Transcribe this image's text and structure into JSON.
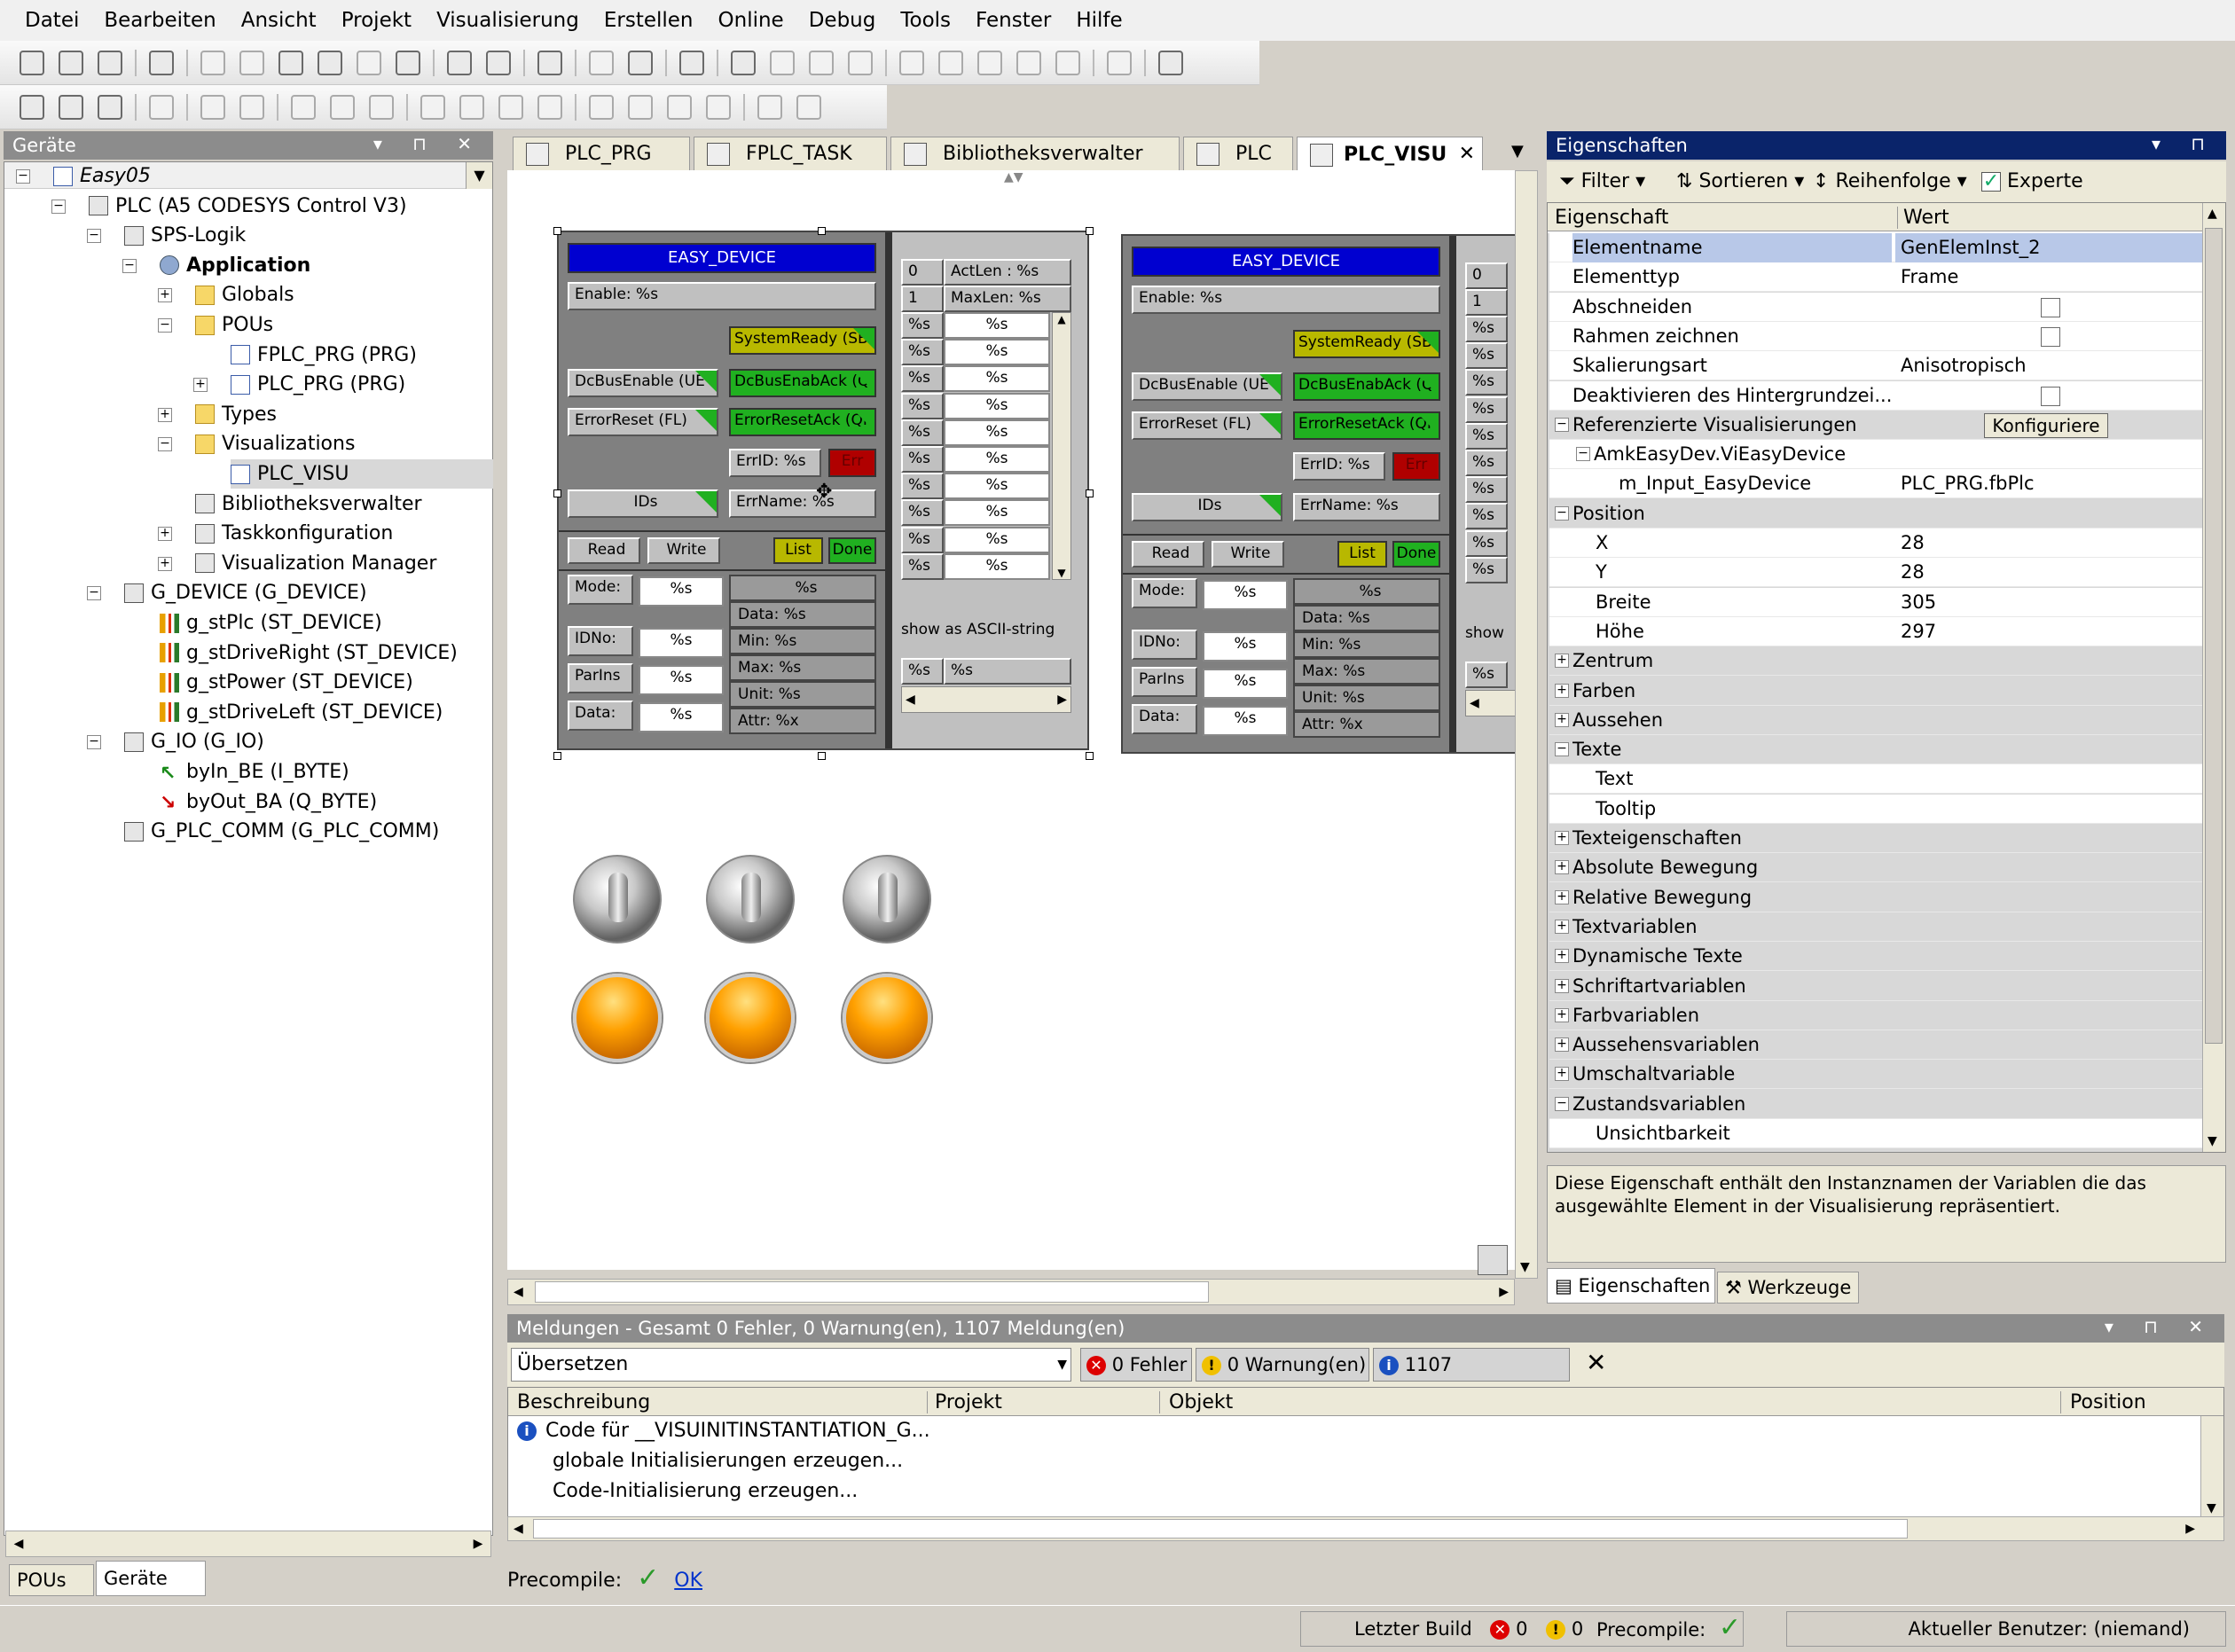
{
  "menu": [
    "Datei",
    "Bearbeiten",
    "Ansicht",
    "Projekt",
    "Visualisierung",
    "Erstellen",
    "Online",
    "Debug",
    "Tools",
    "Fenster",
    "Hilfe"
  ],
  "devices_panel": {
    "title": "Geräte",
    "tree": [
      {
        "label": "Easy05",
        "italic": true
      },
      {
        "label": "PLC (A5 CODESYS Control V3)"
      },
      {
        "label": "SPS-Logik"
      },
      {
        "label": "Application",
        "bold": true
      },
      {
        "label": "Globals"
      },
      {
        "label": "POUs"
      },
      {
        "label": "FPLC_PRG (PRG)"
      },
      {
        "label": "PLC_PRG (PRG)"
      },
      {
        "label": "Types"
      },
      {
        "label": "Visualizations"
      },
      {
        "label": "PLC_VISU",
        "selected": true
      },
      {
        "label": "Bibliotheksverwalter"
      },
      {
        "label": "Taskkonfiguration"
      },
      {
        "label": "Visualization Manager"
      },
      {
        "label": "G_DEVICE (G_DEVICE)"
      },
      {
        "label": "g_stPlc (ST_DEVICE)"
      },
      {
        "label": "g_stDriveRight (ST_DEVICE)"
      },
      {
        "label": "g_stPower (ST_DEVICE)"
      },
      {
        "label": "g_stDriveLeft (ST_DEVICE)"
      },
      {
        "label": "G_IO (G_IO)"
      },
      {
        "label": "byIn_BE (I_BYTE)"
      },
      {
        "label": "byOut_BA (Q_BYTE)"
      },
      {
        "label": "G_PLC_COMM (G_PLC_COMM)"
      }
    ],
    "bottom_tabs": [
      "POUs",
      "Geräte"
    ]
  },
  "editor_tabs": [
    "PLC_PRG",
    "FPLC_TASK",
    "Bibliotheksverwalter",
    "PLC",
    "PLC_VISU"
  ],
  "visu": {
    "device_title": "EASY_DEVICE",
    "enable": "Enable: %s",
    "system_ready": "SystemReady (SB",
    "dc_bus_enable": "DcBusEnable (UE",
    "dc_bus_enab_ack": "DcBusEnabAck (QU",
    "error_reset": "ErrorReset (FL)",
    "error_reset_ack": "ErrorResetAck (QF",
    "err_id": "ErrID: %s",
    "err": "Err",
    "ids": "IDs",
    "err_name": "ErrName: %s",
    "read": "Read",
    "write": "Write",
    "list": "List",
    "done": "Done",
    "mode": "Mode:",
    "idno": "IDNo:",
    "parins": "ParIns",
    "data": "Data:",
    "pct": "%s",
    "data_pct": "Data: %s",
    "min_pct": "Min: %s",
    "max_pct": "Max: %s",
    "unit_pct": "Unit: %s",
    "attr_pct": "Attr: %x",
    "list_row0": [
      "0",
      "ActLen : %s"
    ],
    "list_row1": [
      "1",
      "MaxLen: %s"
    ],
    "show_ascii": "show as ASCII-string",
    "show_short": "show"
  },
  "properties": {
    "title": "Eigenschaften",
    "toolbar": {
      "filter": "Filter",
      "sort": "Sortieren",
      "order": "Reihenfolge",
      "expert": "Experte"
    },
    "col_property": "Eigenschaft",
    "col_value": "Wert",
    "rows": [
      {
        "name": "Elementname",
        "value": "GenElemInst_2",
        "indent": 1,
        "selected": true
      },
      {
        "name": "Elementtyp",
        "value": "Frame",
        "indent": 1
      },
      {
        "name": "Abschneiden",
        "value": "",
        "indent": 1,
        "checkbox": true
      },
      {
        "name": "Rahmen zeichnen",
        "value": "",
        "indent": 1,
        "checkbox": true
      },
      {
        "name": "Skalierungsart",
        "value": "Anisotropisch",
        "indent": 1
      },
      {
        "name": "Deaktivieren des Hintergrundzei...",
        "value": "",
        "indent": 1,
        "checkbox": true
      },
      {
        "name": "Referenzierte Visualisierungen",
        "value": "",
        "indent": 1,
        "exp": "−",
        "button": "Konfiguriere"
      },
      {
        "name": "AmkEasyDev.ViEasyDevice",
        "value": "",
        "indent": 2,
        "exp": "−"
      },
      {
        "name": "m_Input_EasyDevice",
        "value": "PLC_PRG.fbPlc",
        "indent": 3
      },
      {
        "name": "Position",
        "value": "",
        "indent": 1,
        "exp": "−"
      },
      {
        "name": "X",
        "value": "28",
        "indent": 2
      },
      {
        "name": "Y",
        "value": "28",
        "indent": 2
      },
      {
        "name": "Breite",
        "value": "305",
        "indent": 2
      },
      {
        "name": "Höhe",
        "value": "297",
        "indent": 2
      },
      {
        "name": "Zentrum",
        "value": "",
        "indent": 1,
        "exp": "+"
      },
      {
        "name": "Farben",
        "value": "",
        "indent": 1,
        "exp": "+"
      },
      {
        "name": "Aussehen",
        "value": "",
        "indent": 1,
        "exp": "+"
      },
      {
        "name": "Texte",
        "value": "",
        "indent": 1,
        "exp": "−"
      },
      {
        "name": "Text",
        "value": "",
        "indent": 2
      },
      {
        "name": "Tooltip",
        "value": "",
        "indent": 2
      },
      {
        "name": "Texteigenschaften",
        "value": "",
        "indent": 1,
        "exp": "+"
      },
      {
        "name": "Absolute Bewegung",
        "value": "",
        "indent": 1,
        "exp": "+"
      },
      {
        "name": "Relative Bewegung",
        "value": "",
        "indent": 1,
        "exp": "+"
      },
      {
        "name": "Textvariablen",
        "value": "",
        "indent": 1,
        "exp": "+"
      },
      {
        "name": "Dynamische Texte",
        "value": "",
        "indent": 1,
        "exp": "+"
      },
      {
        "name": "Schriftartvariablen",
        "value": "",
        "indent": 1,
        "exp": "+"
      },
      {
        "name": "Farbvariablen",
        "value": "",
        "indent": 1,
        "exp": "+"
      },
      {
        "name": "Aussehensvariablen",
        "value": "",
        "indent": 1,
        "exp": "+"
      },
      {
        "name": "Umschaltvariable",
        "value": "",
        "indent": 1,
        "exp": "+"
      },
      {
        "name": "Zustandsvariablen",
        "value": "",
        "indent": 1,
        "exp": "−"
      },
      {
        "name": "Unsichtbarkeit",
        "value": "",
        "indent": 2
      }
    ],
    "description": "Diese Eigenschaft enthält den Instanznamen der Variablen die das ausgewählte Element in der Visualisierung repräsentiert.",
    "tabs": [
      "Eigenschaften",
      "Werkzeuge"
    ]
  },
  "messages": {
    "title": "Meldungen - Gesamt 0 Fehler, 0 Warnung(en), 1107 Meldung(en)",
    "source": "Übersetzen",
    "errors": "0 Fehler",
    "warnings": "0 Warnung(en)",
    "infos": "1107 Meldung(en)",
    "cols": [
      "Beschreibung",
      "Projekt",
      "Objekt",
      "Position"
    ],
    "rows": [
      "Code für __VISUINITINSTANTIATION_G...",
      "globale Initialisierungen erzeugen...",
      "Code-Initialisierung erzeugen..."
    ]
  },
  "precompile": {
    "label": "Precompile:",
    "status": "OK"
  },
  "status": {
    "last_build": "Letzter Build",
    "errors": "0",
    "warnings": "0",
    "precompile": "Precompile:",
    "user": "Aktueller Benutzer: (niemand)"
  },
  "colors": {
    "accent": "#0a246a",
    "panel_header": "#8c8c8c",
    "visu_title": "#0000d0",
    "ok_green": "#20b020"
  }
}
